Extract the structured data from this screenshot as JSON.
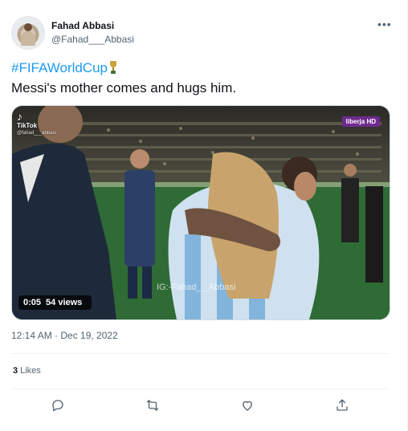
{
  "author": {
    "name": "Fahad Abbasi",
    "handle": "@Fahad___Abbasi"
  },
  "tweet": {
    "hashtag": "#FIFAWorldCup",
    "emoji_icon": "trophy-icon",
    "text": "Messi's mother comes and hugs him."
  },
  "video": {
    "overlay_source": "TikTok",
    "overlay_user": "@fahad___abbasi",
    "tv_logo": "liberja HD",
    "watermark": "IG:-Fahad_ _Abbasi",
    "duration": "0:05",
    "views": "54 views"
  },
  "timestamp": "12:14 AM · Dec 19, 2022",
  "engagement": {
    "likes_count": "3",
    "likes_label": "Likes"
  },
  "actions": [
    "reply-icon",
    "retweet-icon",
    "like-icon",
    "share-icon"
  ],
  "colors": {
    "accent": "#1d9bf0",
    "secondary_text": "#536471",
    "divider": "#eff3f4"
  }
}
